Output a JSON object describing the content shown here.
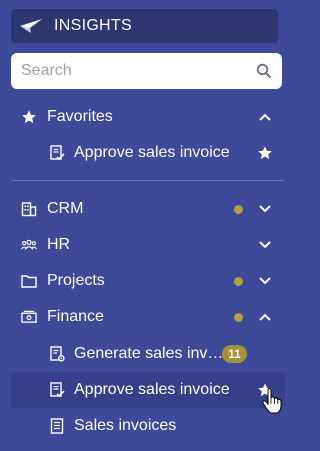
{
  "header": {
    "title": "INSIGHTS",
    "logo_icon": "paper-plane-icon"
  },
  "search": {
    "placeholder": "Search",
    "value": "",
    "icon": "search-icon"
  },
  "favorites": {
    "label": "Favorites",
    "icon": "star-icon",
    "expanded": true,
    "items": [
      {
        "label": "Approve sales invoice",
        "icon": "approve-invoice-icon",
        "starred": true
      }
    ]
  },
  "nav": [
    {
      "label": "CRM",
      "icon": "building-icon",
      "dot": true,
      "expanded": false
    },
    {
      "label": "HR",
      "icon": "people-icon",
      "dot": false,
      "expanded": false
    },
    {
      "label": "Projects",
      "icon": "folder-icon",
      "dot": true,
      "expanded": false
    },
    {
      "label": "Finance",
      "icon": "money-icon",
      "dot": true,
      "expanded": true
    }
  ],
  "finance_items": [
    {
      "label": "Generate sales inv…",
      "icon": "generate-invoice-icon",
      "badge": "11"
    },
    {
      "label": "Approve sales invoice",
      "icon": "approve-invoice-icon",
      "starred": true,
      "hovered": true
    },
    {
      "label": "Sales invoices",
      "icon": "invoice-list-icon"
    }
  ],
  "colors": {
    "background": "#3d4a9a",
    "header": "#2c3670",
    "dot": "#b3a03f",
    "badge": "#a49239"
  }
}
